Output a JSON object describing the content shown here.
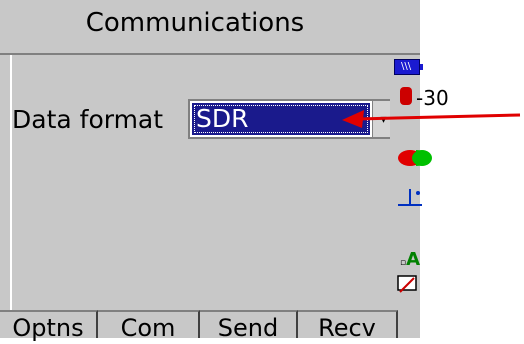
{
  "window": {
    "title": "Communications"
  },
  "form": {
    "data_format_label": "Data format",
    "data_format_value": "SDR"
  },
  "status": {
    "battery_icon": "battery-icon",
    "temperature": "-30"
  },
  "softkeys": [
    "Optns",
    "Com",
    "Send",
    "Recv"
  ],
  "colors": {
    "selection": "#1a1a8c",
    "arrow": "#e00000",
    "battery": "#1a1ad0"
  }
}
